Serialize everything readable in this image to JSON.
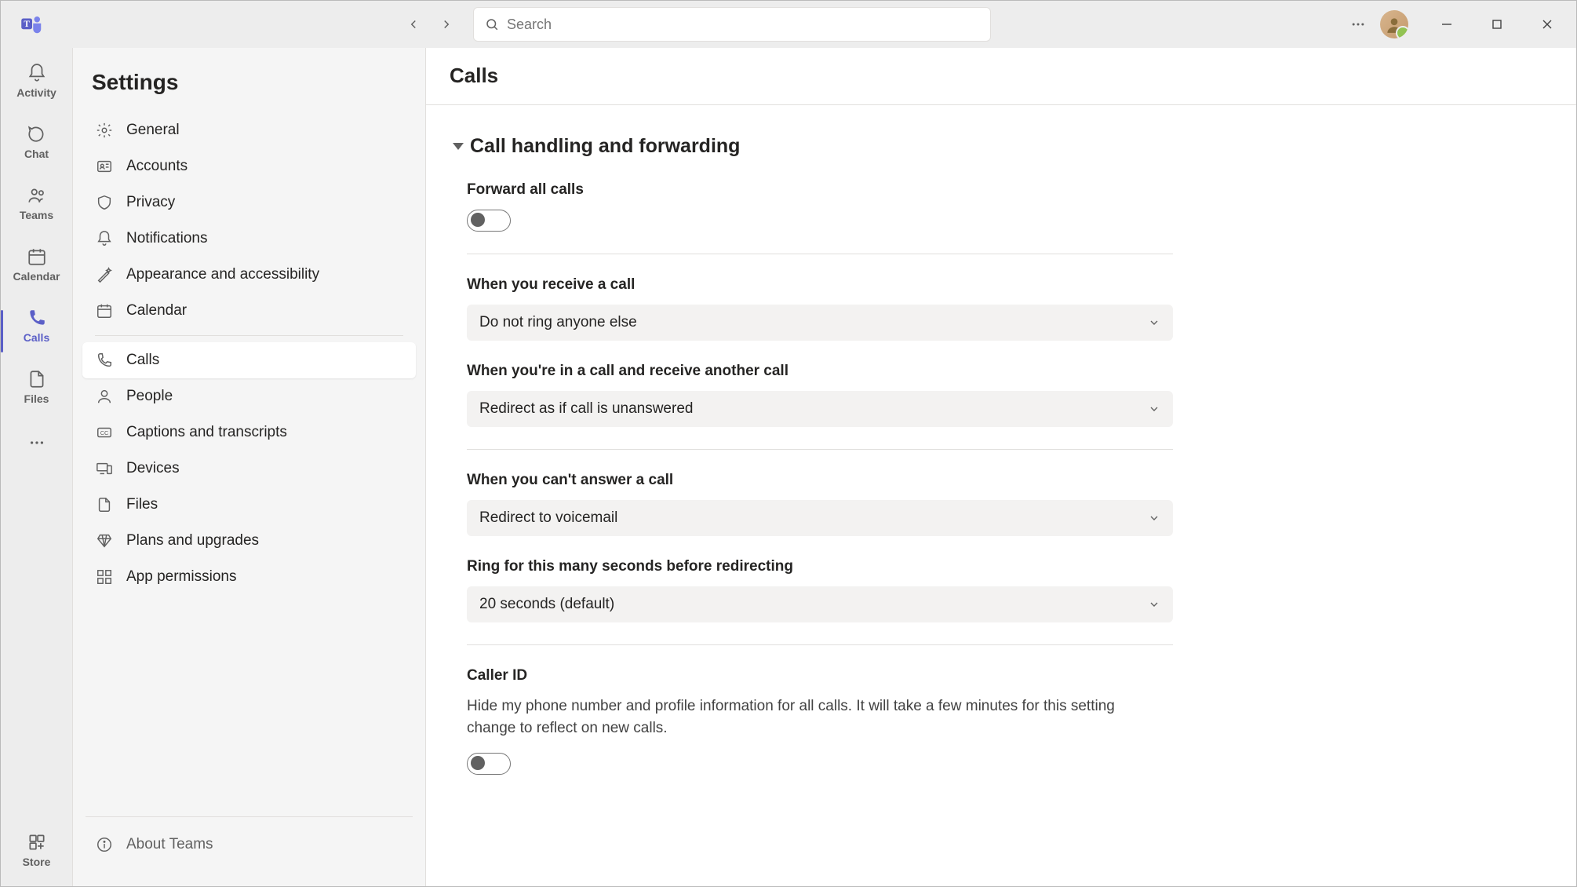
{
  "titlebar": {
    "search_placeholder": "Search"
  },
  "rail": {
    "items": [
      {
        "label": "Activity"
      },
      {
        "label": "Chat"
      },
      {
        "label": "Teams"
      },
      {
        "label": "Calendar"
      },
      {
        "label": "Calls"
      },
      {
        "label": "Files"
      }
    ],
    "store": "Store"
  },
  "panel": {
    "title": "Settings",
    "group1": [
      "General",
      "Accounts",
      "Privacy",
      "Notifications",
      "Appearance and accessibility",
      "Calendar"
    ],
    "group2": [
      "Calls",
      "People",
      "Captions and transcripts",
      "Devices",
      "Files",
      "Plans and upgrades",
      "App permissions"
    ],
    "about": "About Teams"
  },
  "main": {
    "title": "Calls",
    "section": "Call handling and forwarding",
    "forward_label": "Forward all calls",
    "receive_label": "When you receive a call",
    "receive_value": "Do not ring anyone else",
    "another_label": "When you're in a call and receive another call",
    "another_value": "Redirect as if call is unanswered",
    "cant_label": "When you can't answer a call",
    "cant_value": "Redirect to voicemail",
    "ring_label": "Ring for this many seconds before redirecting",
    "ring_value": "20 seconds (default)",
    "caller_label": "Caller ID",
    "caller_desc": "Hide my phone number and profile information for all calls. It will take a few minutes for this setting change to reflect on new calls."
  }
}
